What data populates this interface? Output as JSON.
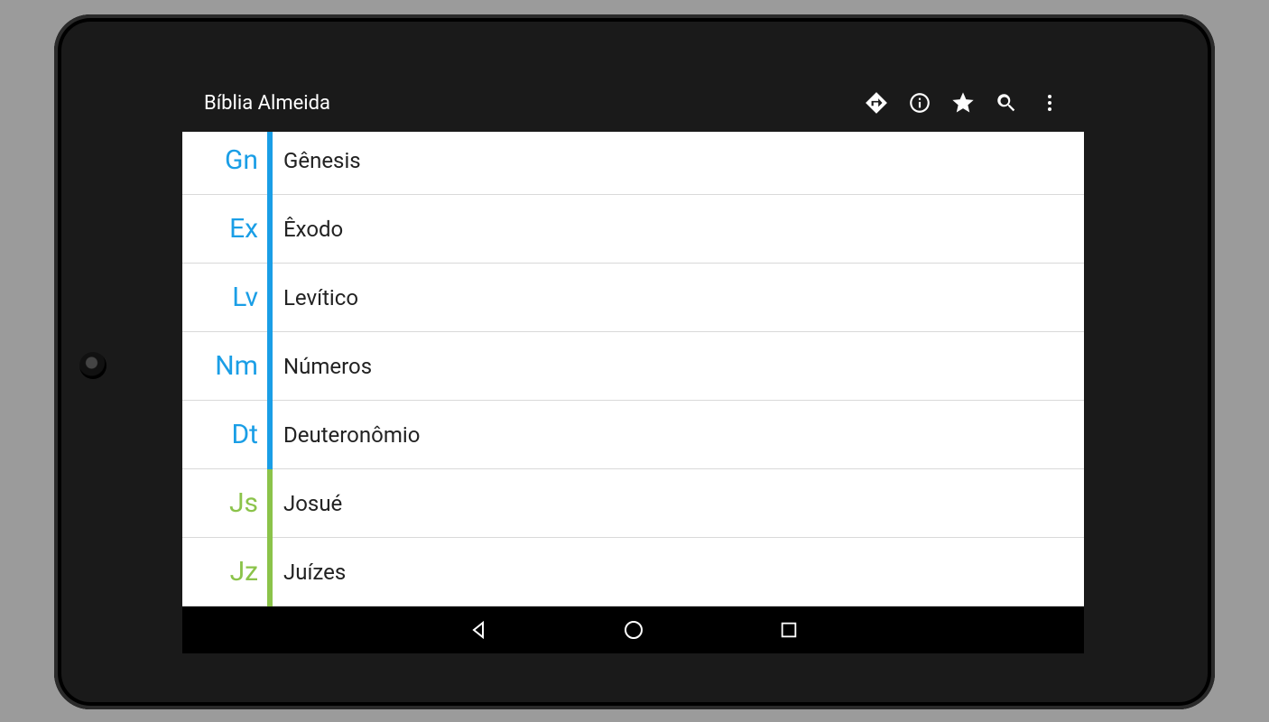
{
  "app_title": "Bíblia Almeida",
  "colors": {
    "blue": "#1a9ee6",
    "green": "#8bc34a"
  },
  "books": [
    {
      "abbr": "Gn",
      "name": "Gênesis",
      "group": "blue"
    },
    {
      "abbr": "Ex",
      "name": "Êxodo",
      "group": "blue"
    },
    {
      "abbr": "Lv",
      "name": "Levítico",
      "group": "blue"
    },
    {
      "abbr": "Nm",
      "name": "Números",
      "group": "blue"
    },
    {
      "abbr": "Dt",
      "name": "Deuteronômio",
      "group": "blue"
    },
    {
      "abbr": "Js",
      "name": "Josué",
      "group": "green"
    },
    {
      "abbr": "Jz",
      "name": "Juízes",
      "group": "green"
    }
  ],
  "toolbar_icons": [
    "directions",
    "info",
    "star",
    "search",
    "overflow"
  ],
  "nav_icons": [
    "back",
    "home",
    "recent"
  ]
}
